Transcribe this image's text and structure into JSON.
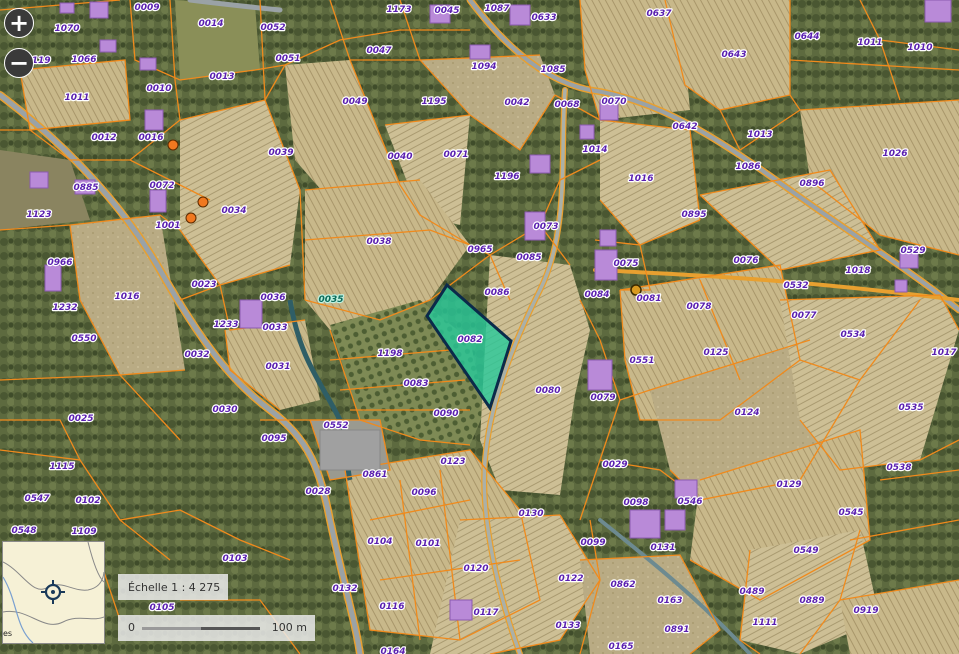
{
  "controls": {
    "zoom_in": "+",
    "zoom_out": "−"
  },
  "scale": {
    "ratio": "Échelle 1 : 4 275",
    "bar_start": "0",
    "bar_end": "100 m"
  },
  "overview": {
    "partial_label": "es",
    "marker_icon": "crosshair-target-icon"
  },
  "colors": {
    "parcel_border": "#f08a1c",
    "selected_fill": "#27c99a",
    "selected_border": "#0b2a4a",
    "road": "#9aa2a6",
    "building": "#b98ad8",
    "river": "#2f5e66"
  },
  "markers": {
    "icon": "orange-dot-marker-icon"
  },
  "selected_parcel": "0035",
  "parcels": [
    "0009",
    "0014",
    "0052",
    "1173",
    "0045",
    "1087",
    "0633",
    "0637",
    "1070",
    "0013",
    "0047",
    "1094",
    "1085",
    "0643",
    "0644",
    "1011",
    "1010",
    "1066",
    "0119",
    "0010",
    "0051",
    "0049",
    "1195",
    "0042",
    "0068",
    "0070",
    "0642",
    "1013",
    "1011",
    "0012",
    "0016",
    "0039",
    "0040",
    "0071",
    "1014",
    "1086",
    "1026",
    "0885",
    "1196",
    "0072",
    "1016",
    "0896",
    "1123",
    "1001",
    "0034",
    "0038",
    "0965",
    "0073",
    "0895",
    "0966",
    "0085",
    "0075",
    "0076",
    "1018",
    "0529",
    "1016",
    "0023",
    "0036",
    "0086",
    "0084",
    "0081",
    "0532",
    "1232",
    "1233",
    "0033",
    "0035",
    "0082",
    "0078",
    "0077",
    "0534",
    "0550",
    "0032",
    "1198",
    "0080",
    "0125",
    "1017",
    "0031",
    "0083",
    "0551",
    "0030",
    "0090",
    "0079",
    "0124",
    "0535",
    "0025",
    "0552",
    "0095",
    "0029",
    "0123",
    "0129",
    "0538",
    "1115",
    "0861",
    "0028",
    "0096",
    "0098",
    "0546",
    "0547",
    "0102",
    "0130",
    "0545",
    "0548",
    "1109",
    "0104",
    "0101",
    "0099",
    "0131",
    "0549",
    "0103",
    "0120",
    "0122",
    "0862",
    "0132",
    "0489",
    "0105",
    "0116",
    "0117",
    "0163",
    "0889",
    "0919",
    "0133",
    "1111",
    "0164",
    "0165",
    "0891"
  ]
}
